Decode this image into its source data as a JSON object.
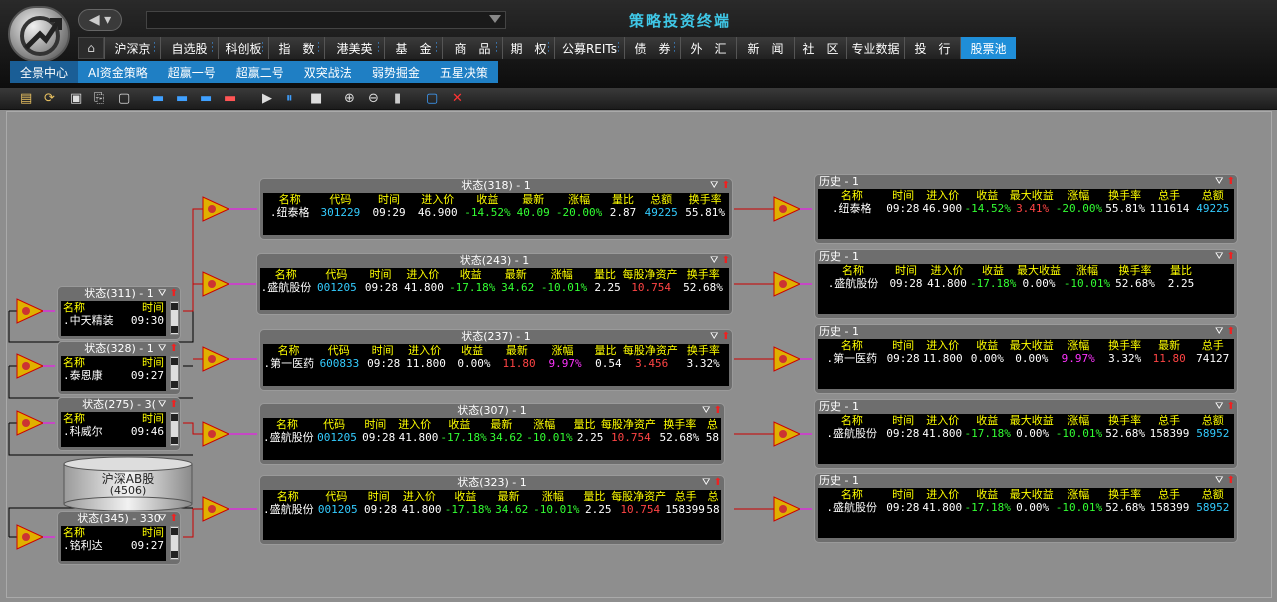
{
  "window": {
    "title": "策略投资终端",
    "accent": "#1f8ed8",
    "title_color": "#3fc7e6"
  },
  "nav": [
    "沪深京",
    "自选股",
    "科创板",
    "指　数",
    "港美英",
    "基　金",
    "商　品",
    "期　权",
    "公募REITs",
    "债　券",
    "外　汇",
    "新　闻",
    "社　区",
    "专业数据",
    "投　行",
    "股票池"
  ],
  "nav_active": "股票池",
  "subnav": [
    "全景中心",
    "AI资金策略",
    "超赢一号",
    "超赢二号",
    "双突战法",
    "弱势掘金",
    "五星决策"
  ],
  "subnav_active": "全景中心",
  "toolbar_icons": [
    "open-folder-icon",
    "refresh-folder-icon",
    "save-icon",
    "export-icon",
    "window-icon",
    "align-top-icon",
    "align-center-icon",
    "align-bottom-icon",
    "align-left-icon",
    "play-icon",
    "pause-icon",
    "stop-icon",
    "zoom-in-icon",
    "zoom-out-icon",
    "trash-icon",
    "fit-icon",
    "close-icon"
  ],
  "left_panels": [
    {
      "title": "状态(311) - 1",
      "headers": [
        "名称",
        "时间"
      ],
      "name": "中天精装",
      "time": "09:30"
    },
    {
      "title": "状态(328) - 1",
      "headers": [
        "名称",
        "时间"
      ],
      "name": "泰恩康",
      "time": "09:27"
    },
    {
      "title": "状态(275) - 3(",
      "headers": [
        "名称",
        "时间"
      ],
      "name": "科威尔",
      "time": "09:46"
    },
    {
      "title": "状态(345) - 330",
      "headers": [
        "名称",
        "时间"
      ],
      "name": "铭利达",
      "time": "09:27"
    }
  ],
  "database": {
    "label": "沪深AB股",
    "count": "(4506)"
  },
  "mid_panels": [
    {
      "title": "状态(318) - 1",
      "headers": [
        "名称",
        "代码",
        "时间",
        "进入价",
        "收益",
        "最新",
        "涨幅",
        "量比",
        "总额",
        "换手率"
      ],
      "row": [
        "纽泰格",
        "301229",
        "09:29",
        "46.900",
        "-14.52%",
        "40.09",
        "-20.00%",
        "2.87",
        "49225",
        "55.81%"
      ]
    },
    {
      "title": "状态(243) - 1",
      "headers": [
        "名称",
        "代码",
        "时间",
        "进入价",
        "收益",
        "最新",
        "涨幅",
        "量比",
        "每股净资产",
        "换手率"
      ],
      "row": [
        "盛航股份",
        "001205",
        "09:28",
        "41.800",
        "-17.18%",
        "34.62",
        "-10.01%",
        "2.25",
        "10.754",
        "52.68%"
      ]
    },
    {
      "title": "状态(237) - 1",
      "headers": [
        "名称",
        "代码",
        "时间",
        "进入价",
        "收益",
        "最新",
        "涨幅",
        "量比",
        "每股净资产",
        "换手率"
      ],
      "row": [
        "第一医药",
        "600833",
        "09:28",
        "11.800",
        "0.00%",
        "11.80",
        "9.97%",
        "0.54",
        "3.456",
        "3.32%"
      ]
    },
    {
      "title": "状态(307) - 1",
      "headers": [
        "名称",
        "代码",
        "时间",
        "进入价",
        "收益",
        "最新",
        "涨幅",
        "量比",
        "每股净资产",
        "换手率",
        "总"
      ],
      "row": [
        "盛航股份",
        "001205",
        "09:28",
        "41.800",
        "-17.18%",
        "34.62",
        "-10.01%",
        "2.25",
        "10.754",
        "52.68%",
        "58"
      ]
    },
    {
      "title": "状态(323) - 1",
      "headers": [
        "名称",
        "代码",
        "时间",
        "进入价",
        "收益",
        "最新",
        "涨幅",
        "量比",
        "每股净资产",
        "总手",
        "总"
      ],
      "row": [
        "盛航股份",
        "001205",
        "09:28",
        "41.800",
        "-17.18%",
        "34.62",
        "-10.01%",
        "2.25",
        "10.754",
        "158399",
        "58"
      ]
    }
  ],
  "right_panels": [
    {
      "title": "历史 - 1",
      "headers": [
        "名称",
        "时间",
        "进入价",
        "收益",
        "最大收益",
        "涨幅",
        "换手率",
        "总手",
        "总额"
      ],
      "row": [
        "纽泰格",
        "09:28",
        "46.900",
        "-14.52%",
        "3.41%",
        "-20.00%",
        "55.81%",
        "111614",
        "49225"
      ]
    },
    {
      "title": "历史 - 1",
      "headers": [
        "名称",
        "时间",
        "进入价",
        "收益",
        "最大收益",
        "涨幅",
        "换手率",
        "量比"
      ],
      "row": [
        "盛航股份",
        "09:28",
        "41.800",
        "-17.18%",
        "0.00%",
        "-10.01%",
        "52.68%",
        "2.25"
      ]
    },
    {
      "title": "历史 - 1",
      "headers": [
        "名称",
        "时间",
        "进入价",
        "收益",
        "最大收益",
        "涨幅",
        "换手率",
        "最新",
        "总手"
      ],
      "row": [
        "第一医药",
        "09:28",
        "11.800",
        "0.00%",
        "0.00%",
        "9.97%",
        "3.32%",
        "11.80",
        "74127"
      ]
    },
    {
      "title": "历史 - 1",
      "headers": [
        "名称",
        "时间",
        "进入价",
        "收益",
        "最大收益",
        "涨幅",
        "换手率",
        "总手",
        "总额"
      ],
      "row": [
        "盛航股份",
        "09:28",
        "41.800",
        "-17.18%",
        "0.00%",
        "-10.01%",
        "52.68%",
        "158399",
        "58952"
      ]
    },
    {
      "title": "历史 - 1",
      "headers": [
        "名称",
        "时间",
        "进入价",
        "收益",
        "最大收益",
        "涨幅",
        "换手率",
        "总手",
        "总额"
      ],
      "row": [
        "盛航股份",
        "09:28",
        "41.800",
        "-17.18%",
        "0.00%",
        "-10.01%",
        "52.68%",
        "158399",
        "58952"
      ]
    }
  ]
}
